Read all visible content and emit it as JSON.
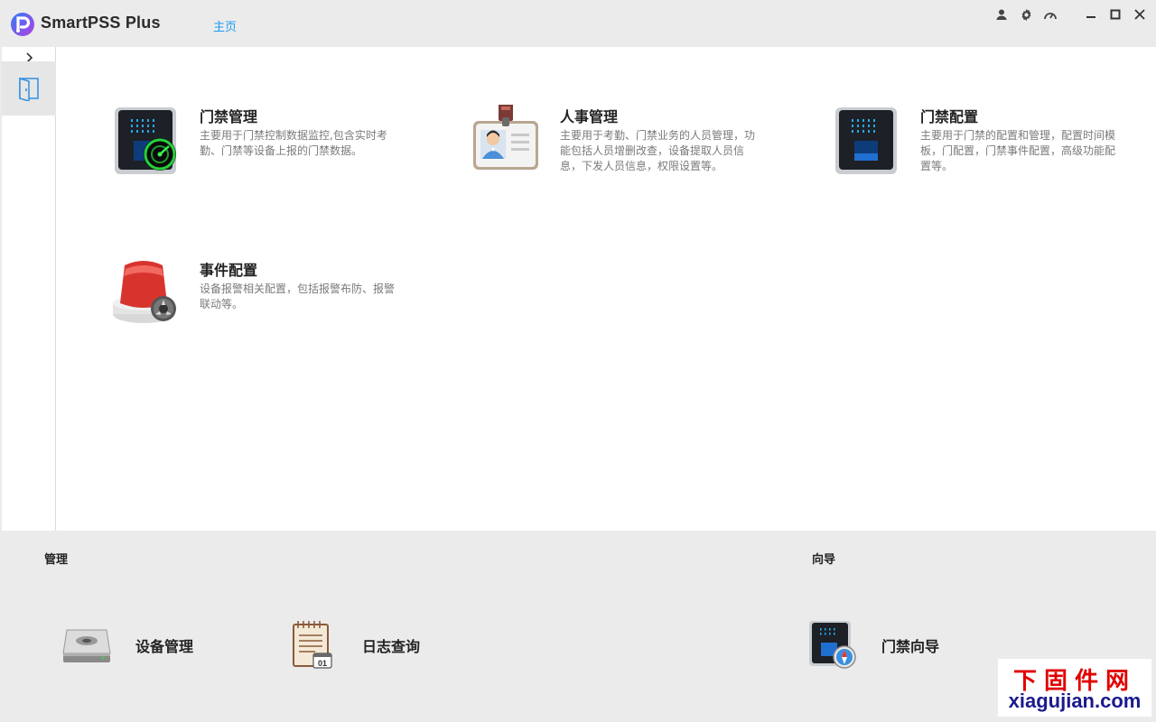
{
  "app": {
    "name": "SmartPSS Plus",
    "active_tab": "主页",
    "brand_color": "#1c9bf0"
  },
  "window_controls": {
    "icons": [
      "user-icon",
      "gear-icon",
      "gauge-icon",
      "minimize-icon",
      "maximize-icon",
      "close-icon"
    ]
  },
  "sidebar": {
    "items": [
      {
        "icon": "door-icon"
      }
    ]
  },
  "modules": [
    {
      "title": "门禁管理",
      "desc": "主要用于门禁控制数据监控,包含实时考勤、门禁等设备上报的门禁数据。",
      "icon": "access-control-radar-icon"
    },
    {
      "title": "人事管理",
      "desc": "主要用于考勤、门禁业务的人员管理，功能包括人员增删改查，设备提取人员信息，下发人员信息，权限设置等。",
      "icon": "id-badge-icon"
    },
    {
      "title": "门禁配置",
      "desc": "主要用于门禁的配置和管理，配置时间模板，门配置，门禁事件配置，高级功能配置等。",
      "icon": "access-terminal-icon"
    },
    {
      "title": "事件配置",
      "desc": "设备报警相关配置，包括报警布防、报警联动等。",
      "icon": "alarm-siren-icon"
    }
  ],
  "management": {
    "label": "管理",
    "tools": [
      {
        "label": "设备管理",
        "icon": "device-drive-icon"
      },
      {
        "label": "日志查询",
        "icon": "log-notebook-icon"
      }
    ]
  },
  "wizard": {
    "label": "向导",
    "tools": [
      {
        "label": "门禁向导",
        "icon": "access-wizard-icon"
      }
    ]
  },
  "watermark": {
    "cn": "下固件网",
    "en": "xiagujian.com"
  }
}
